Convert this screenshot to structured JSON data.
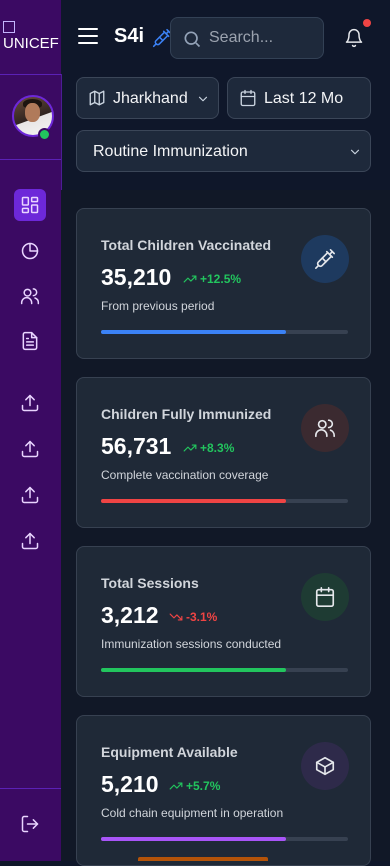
{
  "logo": {
    "text": "UNICEF"
  },
  "header": {
    "brand": "S4i",
    "search_placeholder": "Search..."
  },
  "filters": {
    "region": "Jharkhand",
    "period": "Last 12 Mo",
    "program": "Routine Immunization"
  },
  "sidebar": {
    "items": [
      {
        "name": "dashboard",
        "icon": "layout-grid-icon",
        "active": true
      },
      {
        "name": "reports-chart",
        "icon": "pie-chart-icon",
        "active": false
      },
      {
        "name": "users",
        "icon": "users-icon",
        "active": false
      },
      {
        "name": "documents",
        "icon": "file-text-icon",
        "active": false
      },
      {
        "name": "upload-1",
        "icon": "upload-icon",
        "active": false
      },
      {
        "name": "upload-2",
        "icon": "upload-icon",
        "active": false
      },
      {
        "name": "upload-3",
        "icon": "upload-icon",
        "active": false
      },
      {
        "name": "upload-4",
        "icon": "upload-icon",
        "active": false
      }
    ],
    "logout_icon": "logout-icon"
  },
  "cards": [
    {
      "title": "Total Children Vaccinated",
      "value": "35,210",
      "change": "+12.5%",
      "direction": "up",
      "subtitle": "From previous period",
      "progress": 0.75,
      "bar_color": "#3b82f6",
      "icon": "syringe-icon",
      "icon_color": "#e5e7eb",
      "badge_color": "#1e3a5f"
    },
    {
      "title": "Children Fully Immunized",
      "value": "56,731",
      "change": "+8.3%",
      "direction": "up",
      "subtitle": "Complete vaccination coverage",
      "progress": 0.75,
      "bar_color": "#ef4444",
      "icon": "users-icon",
      "icon_color": "#e5e7eb",
      "badge_color": "#3b2a30"
    },
    {
      "title": "Total Sessions",
      "value": "3,212",
      "change": "-3.1%",
      "direction": "down",
      "subtitle": "Immunization sessions conducted",
      "progress": 0.75,
      "bar_color": "#22c55e",
      "icon": "calendar-icon",
      "icon_color": "#e5e7eb",
      "badge_color": "#1e3b33"
    },
    {
      "title": "Equipment Available",
      "value": "5,210",
      "change": "+5.7%",
      "direction": "up",
      "subtitle": "Cold chain equipment in operation",
      "progress": 0.75,
      "bar_color": "#a855f7",
      "icon": "box-icon",
      "icon_color": "#e5e7eb",
      "badge_color": "#2e2a4a"
    }
  ],
  "colors": {
    "up": "#22c55e",
    "down": "#ef4444",
    "sidebar_bg": "#3b0a63",
    "accent": "#6d28d9"
  }
}
